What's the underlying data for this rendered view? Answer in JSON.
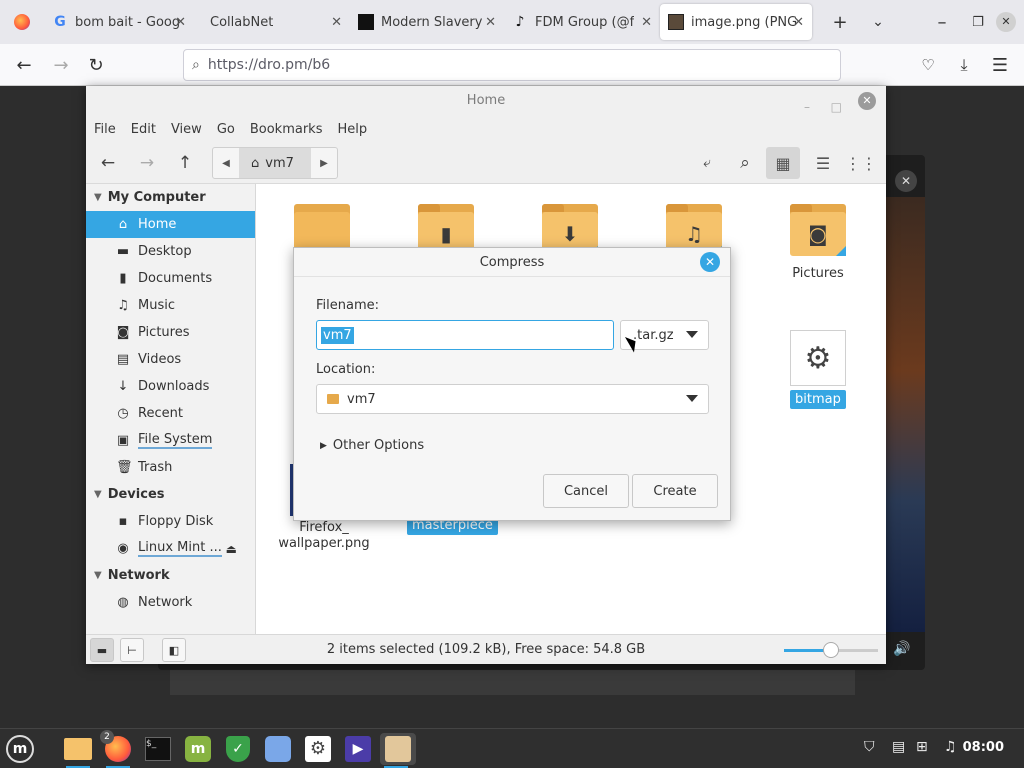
{
  "browser": {
    "tabs": [
      {
        "title": "bom bait - Goog",
        "favicon": "google-icon"
      },
      {
        "title": "CollabNet",
        "favicon": "none"
      },
      {
        "title": "Modern Slavery",
        "favicon": "site-icon"
      },
      {
        "title": "FDM Group (@f",
        "favicon": "tiktok-icon"
      },
      {
        "title": "image.png (PNG",
        "favicon": "image-icon",
        "active": true
      }
    ],
    "url": "https://dro.pm/b6"
  },
  "file_manager": {
    "title": "Home",
    "menu": [
      "File",
      "Edit",
      "View",
      "Go",
      "Bookmarks",
      "Help"
    ],
    "breadcrumb": "vm7",
    "sidebar": {
      "sections": [
        {
          "title": "My Computer",
          "items": [
            "Home",
            "Desktop",
            "Documents",
            "Music",
            "Pictures",
            "Videos",
            "Downloads",
            "Recent",
            "File System",
            "Trash"
          ]
        },
        {
          "title": "Devices",
          "items": [
            "Floppy Disk",
            "Linux Mint ..."
          ]
        },
        {
          "title": "Network",
          "items": [
            "Network"
          ]
        }
      ],
      "selected": "Home"
    },
    "content": {
      "pictures_label": "Pictures",
      "bitmap_label": "bitmap",
      "firefox_label_1": "Firefox_",
      "firefox_label_2": "wallpaper.png",
      "masterpiece_label": "masterpiece"
    },
    "status": "2 items selected (109.2 kB), Free space: 54.8 GB",
    "zoom_level": 0.5
  },
  "dialog": {
    "title": "Compress",
    "filename_label": "Filename:",
    "filename_value": "vm7",
    "format": ".tar.gz",
    "location_label": "Location:",
    "location_value": "vm7",
    "other_options": "Other Options",
    "cancel": "Cancel",
    "create": "Create"
  },
  "taskbar": {
    "clock": "08:00",
    "badge": "2"
  },
  "colors": {
    "accent": "#35a6e3",
    "folder": "#f5c26b"
  }
}
